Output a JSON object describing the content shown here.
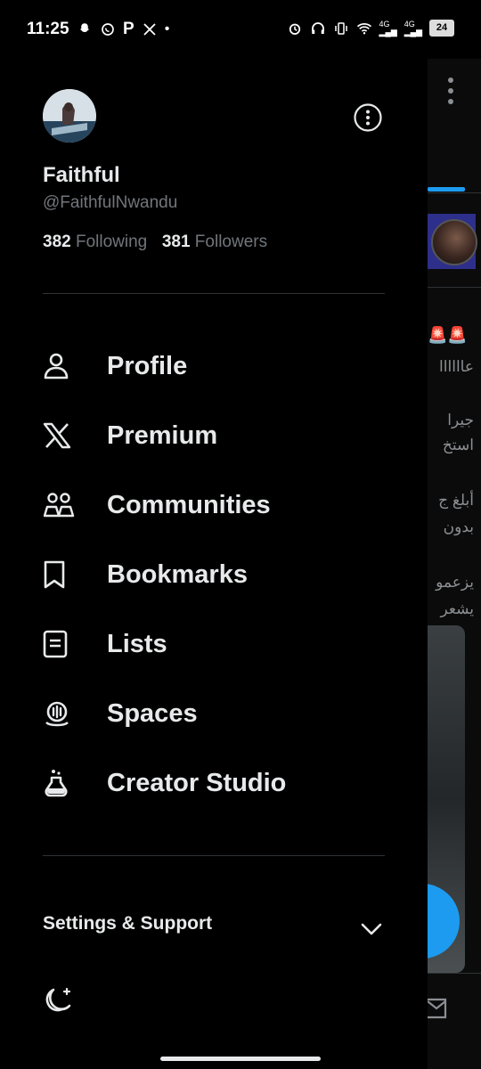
{
  "status_bar": {
    "time": "11:25",
    "battery": "24",
    "network_1": "4G",
    "network_2": "4G"
  },
  "profile": {
    "name": "Faithful",
    "handle": "@FaithfulNwandu",
    "following_count": "382",
    "following_label": "Following",
    "followers_count": "381",
    "followers_label": "Followers"
  },
  "menu": [
    {
      "label": "Profile",
      "icon": "person-icon"
    },
    {
      "label": "Premium",
      "icon": "x-logo-icon"
    },
    {
      "label": "Communities",
      "icon": "communities-icon"
    },
    {
      "label": "Bookmarks",
      "icon": "bookmark-icon"
    },
    {
      "label": "Lists",
      "icon": "lists-icon"
    },
    {
      "label": "Spaces",
      "icon": "spaces-icon"
    },
    {
      "label": "Creator Studio",
      "icon": "flask-icon"
    }
  ],
  "settings_label": "Settings & Support",
  "background": {
    "lines": [
      "عاااااا",
      "جيرا",
      "استخ",
      "أبلغ ج",
      "بدون",
      "يزعمو",
      "يشعر"
    ]
  }
}
